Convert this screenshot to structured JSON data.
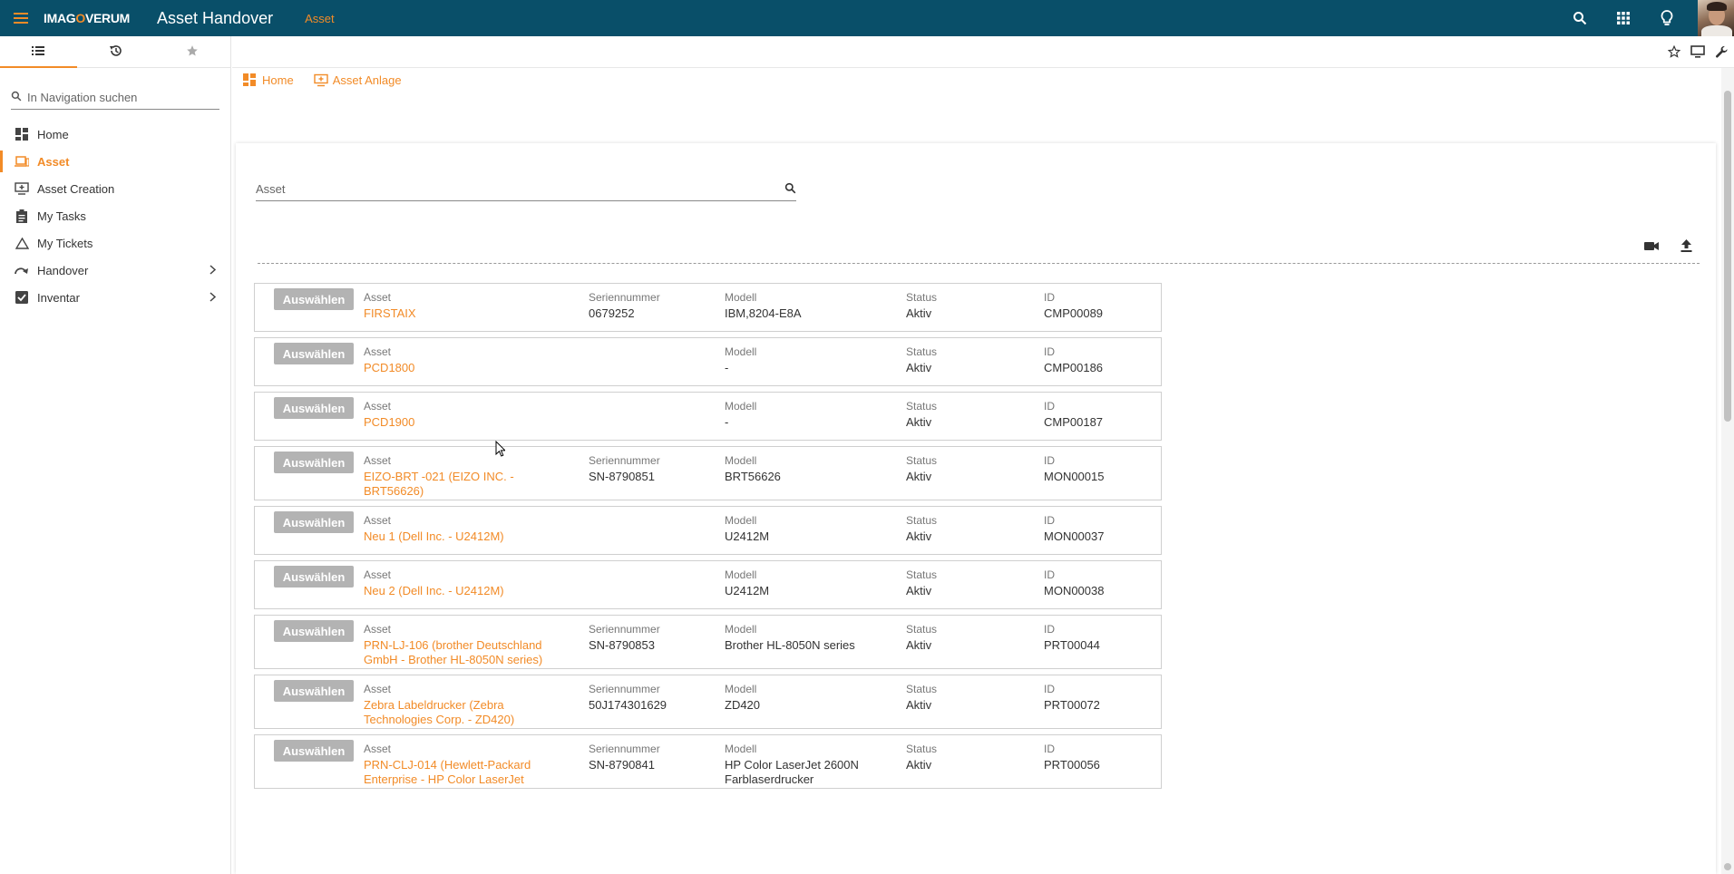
{
  "topbar": {
    "logo_pre": "IMAG",
    "logo_o": "O",
    "logo_post": "VERUM",
    "app_title": "Asset Handover",
    "current_section": "Asset",
    "icons": [
      "search-icon",
      "apps-grid-icon",
      "lightbulb-icon",
      "user-avatar"
    ]
  },
  "toolbar2": {
    "icons": [
      "star-outline-icon",
      "monitor-icon",
      "wrench-icon"
    ]
  },
  "sidebar": {
    "tabs": [
      "list-icon",
      "history-icon",
      "star-icon"
    ],
    "search_placeholder": "In Navigation suchen",
    "items": [
      {
        "label": "Home",
        "icon": "dashboard-icon"
      },
      {
        "label": "Asset",
        "icon": "laptop-icon"
      },
      {
        "label": "Asset Creation",
        "icon": "asset-add-icon"
      },
      {
        "label": "My Tasks",
        "icon": "clipboard-icon"
      },
      {
        "label": "My Tickets",
        "icon": "warning-triangle-icon"
      },
      {
        "label": "Handover",
        "icon": "redo-icon"
      },
      {
        "label": "Inventar",
        "icon": "checkbox-icon"
      }
    ]
  },
  "breadcrumb": [
    {
      "label": "Home",
      "icon": "dashboard-icon"
    },
    {
      "label": "Asset Anlage",
      "icon": "asset-add-icon"
    }
  ],
  "asset_search": {
    "placeholder": "Asset"
  },
  "card_actions": [
    "video-camera-icon",
    "upload-icon"
  ],
  "columns": {
    "asset": "Asset",
    "serial": "Seriennummer",
    "model": "Modell",
    "status": "Status",
    "id": "ID"
  },
  "select_label": "Auswählen",
  "rows": [
    {
      "asset_lines": [
        "FIRSTAIX"
      ],
      "serial": "0679252",
      "model_lines": [
        "IBM,8204-E8A"
      ],
      "status": "Aktiv",
      "id": "CMP00089"
    },
    {
      "asset_lines": [
        "PCD1800"
      ],
      "serial": "",
      "model_lines": [
        "-"
      ],
      "status": "Aktiv",
      "id": "CMP00186"
    },
    {
      "asset_lines": [
        "PCD1900"
      ],
      "serial": "",
      "model_lines": [
        "-"
      ],
      "status": "Aktiv",
      "id": "CMP00187"
    },
    {
      "asset_lines": [
        "EIZO-BRT -021 (EIZO INC. -",
        "BRT56626)"
      ],
      "serial": "SN-8790851",
      "model_lines": [
        "BRT56626"
      ],
      "status": "Aktiv",
      "id": "MON00015"
    },
    {
      "asset_lines": [
        "Neu 1 (Dell Inc. - U2412M)"
      ],
      "serial": "",
      "model_lines": [
        "U2412M"
      ],
      "status": "Aktiv",
      "id": "MON00037"
    },
    {
      "asset_lines": [
        "Neu 2 (Dell Inc. - U2412M)"
      ],
      "serial": "",
      "model_lines": [
        "U2412M"
      ],
      "status": "Aktiv",
      "id": "MON00038"
    },
    {
      "asset_lines": [
        "PRN-LJ-106 (brother Deutschland",
        "GmbH - Brother HL-8050N series)"
      ],
      "serial": "SN-8790853",
      "model_lines": [
        "Brother HL-8050N series"
      ],
      "status": "Aktiv",
      "id": "PRT00044"
    },
    {
      "asset_lines": [
        "Zebra Labeldrucker (Zebra",
        "Technologies Corp. - ZD420)"
      ],
      "serial": "50J174301629",
      "model_lines": [
        "ZD420"
      ],
      "status": "Aktiv",
      "id": "PRT00072"
    },
    {
      "asset_lines": [
        "PRN-CLJ-014 (Hewlett-Packard",
        "Enterprise - HP Color LaserJet"
      ],
      "serial": "SN-8790841",
      "model_lines": [
        "HP Color LaserJet 2600N",
        "Farblaserdrucker"
      ],
      "status": "Aktiv",
      "id": "PRT00056"
    }
  ],
  "colors": {
    "topbar": "#094f69",
    "accent": "#f28b27",
    "button": "#b3b3b3"
  }
}
